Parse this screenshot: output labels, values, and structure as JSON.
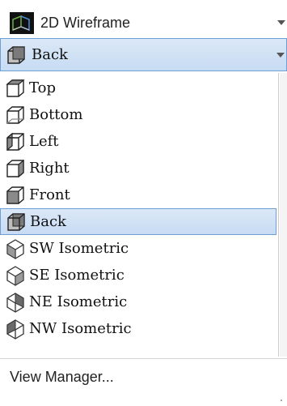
{
  "visual_style": {
    "label": "2D Wireframe",
    "icon": "wireframe-2d-icon"
  },
  "current_view": {
    "label": "Back",
    "icon": "view-back-cube-icon"
  },
  "views": [
    {
      "label": "Top",
      "icon": "view-top-cube-icon"
    },
    {
      "label": "Bottom",
      "icon": "view-bottom-cube-icon"
    },
    {
      "label": "Left",
      "icon": "view-left-cube-icon"
    },
    {
      "label": "Right",
      "icon": "view-right-cube-icon"
    },
    {
      "label": "Front",
      "icon": "view-front-cube-icon"
    },
    {
      "label": "Back",
      "icon": "view-back-cube-icon",
      "selected": true
    },
    {
      "label": "SW Isometric",
      "icon": "sw-isometric-icon"
    },
    {
      "label": "SE Isometric",
      "icon": "se-isometric-icon"
    },
    {
      "label": "NE Isometric",
      "icon": "ne-isometric-icon"
    },
    {
      "label": "NW Isometric",
      "icon": "nw-isometric-icon"
    }
  ],
  "footer": {
    "view_manager_label": "View Manager..."
  },
  "colors": {
    "selection_fill": "#c7dbf3",
    "selection_border": "#6e9fd4"
  }
}
